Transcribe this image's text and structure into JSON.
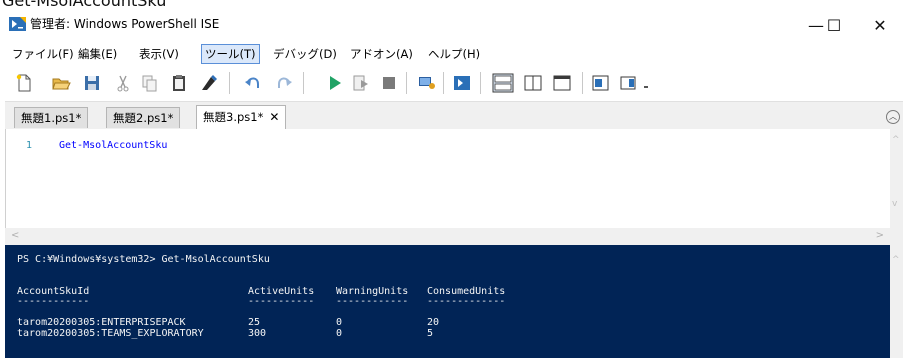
{
  "cropped_heading": "Get-MsolAccountSku",
  "window": {
    "title": "管理者: Windows PowerShell ISE",
    "minimize_glyph": "—",
    "maximize_glyph": "☐",
    "close_glyph": "✕"
  },
  "menu": {
    "items": [
      "ファイル(F)",
      "編集(E)",
      "表示(V)",
      "ツール(T)",
      "デバッグ(D)",
      "アドオン(A)",
      "ヘルプ(H)"
    ],
    "active_index": 3
  },
  "toolbar": {
    "icons": [
      "new-file-icon",
      "open-folder-icon",
      "save-icon",
      "cut-icon",
      "copy-icon",
      "paste-icon",
      "clear-console-icon",
      "undo-icon",
      "redo-icon",
      "run-icon",
      "run-selection-icon",
      "stop-icon",
      "remote-powershell-icon",
      "powershell-console-icon",
      "show-script-top-icon",
      "show-script-right-icon",
      "show-script-max-icon",
      "commands-addon-icon",
      "show-command-window-icon"
    ]
  },
  "tabs": [
    {
      "label": "無題1.ps1*",
      "active": false
    },
    {
      "label": "無題2.ps1*",
      "active": false
    },
    {
      "label": "無題3.ps1*",
      "active": true,
      "close": "✕"
    }
  ],
  "editor": {
    "line_number": "1",
    "code": "Get-MsolAccountSku"
  },
  "console": {
    "prompt": "PS C:¥Windows¥system32> Get-MsolAccountSku",
    "headers": [
      "AccountSkuId",
      "ActiveUnits",
      "WarningUnits",
      "ConsumedUnits"
    ],
    "underlines": [
      "------------",
      "-----------",
      "------------",
      "-------------"
    ],
    "rows": [
      [
        "tarom20200305:ENTERPRISEPACK",
        "25",
        "0",
        "20"
      ],
      [
        "tarom20200305:TEAMS_EXPLORATORY",
        "300",
        "0",
        "5"
      ]
    ]
  },
  "colors": {
    "console_bg": "#012456",
    "console_fg": "#f5f5f5",
    "code_keyword": "#0000ff",
    "line_number": "#2b91af",
    "menu_active_border": "#5a8fd8"
  }
}
